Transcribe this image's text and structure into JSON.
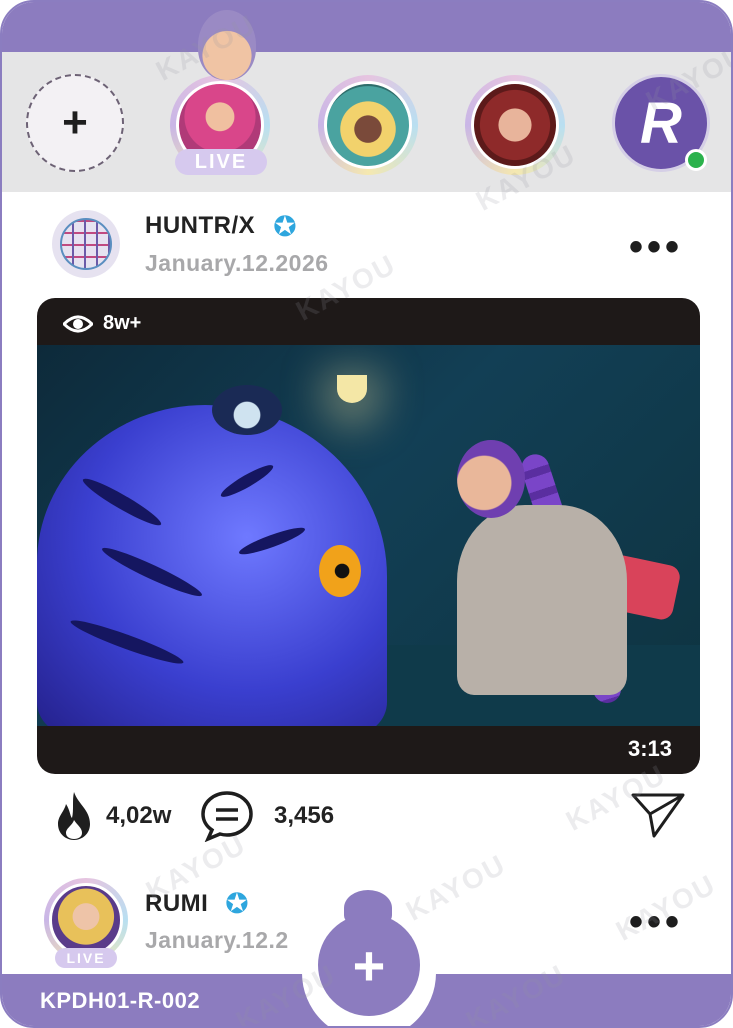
{
  "stories": {
    "add_label": "+",
    "items": [
      {
        "name": "story-1",
        "live": true
      },
      {
        "name": "story-2",
        "live": false
      },
      {
        "name": "story-3",
        "live": false
      }
    ],
    "live_label": "LIVE",
    "brand_letter": "R",
    "online_color": "#2bb24c"
  },
  "post": {
    "username": "HUNTR/X",
    "date": "January.12.2026",
    "more_label": "•••",
    "views": "8w+",
    "duration": "3:13",
    "likes": "4,02w",
    "comments": "3,456"
  },
  "post2": {
    "username": "RUMI",
    "date": "January.12.2",
    "live_label": "LIVE",
    "more_label": "•••"
  },
  "footer": {
    "card_code": "KPDH01-R-002",
    "fab_label": "+"
  },
  "watermark": "KAYOU",
  "colors": {
    "accent": "#8c7cbf",
    "verified": "#2ea6de",
    "story_band": "#e5e5e6"
  }
}
